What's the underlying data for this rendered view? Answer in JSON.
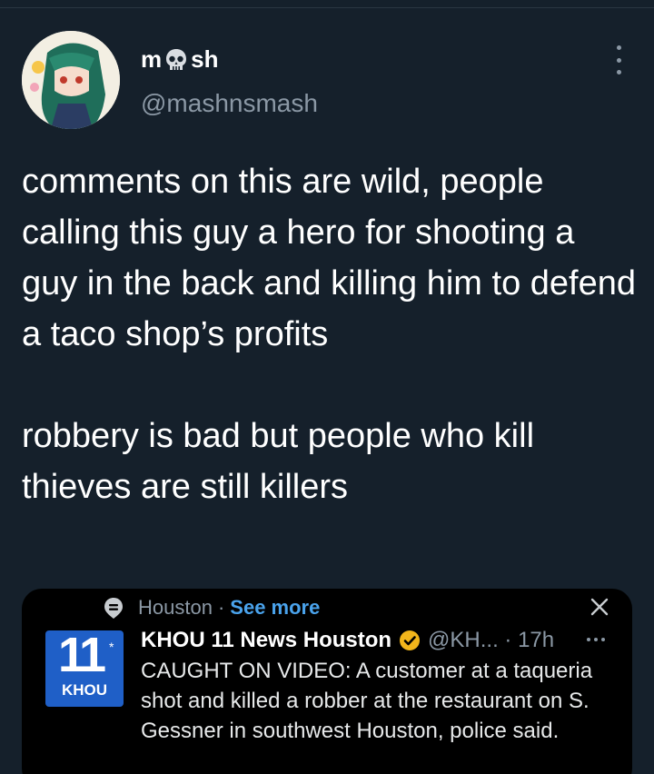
{
  "tweet": {
    "display_name_left": "m",
    "display_name_emoji": "skull-emoji",
    "display_name_right": "sh",
    "handle": "@mashnsmash",
    "paragraphs": [
      "comments on this are wild, people calling this guy a hero for shooting a guy in the back and killing him to defend a taco shop’s profits",
      "robbery is bad but people who kill thieves are still killers"
    ],
    "more_icon": "more-vertical-icon"
  },
  "embedded": {
    "location": "Houston",
    "separator": "·",
    "see_more": "See more",
    "close_icon": "close-icon",
    "source_name": "KHOU 11 News Houston",
    "verified_icon": "verified-badge-icon",
    "source_meta": "@KH... · 17h",
    "logo_number": "11",
    "logo_star": "*",
    "logo_text": "KHOU",
    "text": "CAUGHT ON VIDEO: A customer at a taqueria shot and killed a robber at the restaurant on S. Gessner in southwest Houston, police said."
  },
  "colors": {
    "background": "#15202b",
    "text": "#ffffff",
    "secondary": "#8b98a5",
    "link": "#4aa3ec",
    "verified": "#f2b51b",
    "logo": "#1f5fc7"
  }
}
